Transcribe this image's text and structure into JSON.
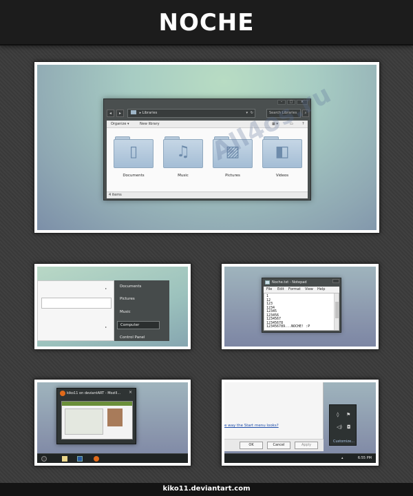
{
  "header": {
    "title": "NOCHE"
  },
  "footer": {
    "credit": "kiko11.deviantart.com"
  },
  "watermark": {
    "text": "All4os.ru"
  },
  "explorer": {
    "address": "Libraries",
    "search_placeholder": "Search Libraries",
    "toolbar": {
      "organize": "Organize ▾",
      "new_library": "New library"
    },
    "libraries": [
      {
        "name": "Documents",
        "icon": "document-icon"
      },
      {
        "name": "Music",
        "icon": "music-note-icon"
      },
      {
        "name": "Pictures",
        "icon": "picture-icon"
      },
      {
        "name": "Videos",
        "icon": "video-camera-icon"
      }
    ],
    "status": "4 items"
  },
  "start_menu": {
    "items": [
      "Documents",
      "Pictures",
      "Music",
      "Computer",
      "Control Panel"
    ],
    "selected": "Computer"
  },
  "notepad": {
    "title": "Noche.txt - Notepad",
    "menu": [
      "File",
      "Edit",
      "Format",
      "View",
      "Help"
    ],
    "lines": [
      "1",
      "12",
      "123",
      "1234",
      "12345",
      "123456",
      "1234567",
      "12345678",
      "123456789...NOCHE! :P"
    ]
  },
  "taskbar_preview": {
    "title": "kiko11 on deviantART - Mozill..."
  },
  "dialog": {
    "link": "e way the Start menu looks?",
    "buttons": [
      "OK",
      "Cancel",
      "Apply"
    ]
  },
  "tray": {
    "customize": "Customize...",
    "time": "6:55 PM"
  },
  "colors": {
    "header_bg": "#1c1c1c",
    "page_bg": "#3b3b3b",
    "window_chrome": "#4a4f4f",
    "folder_blue": "#a4bdd5"
  }
}
